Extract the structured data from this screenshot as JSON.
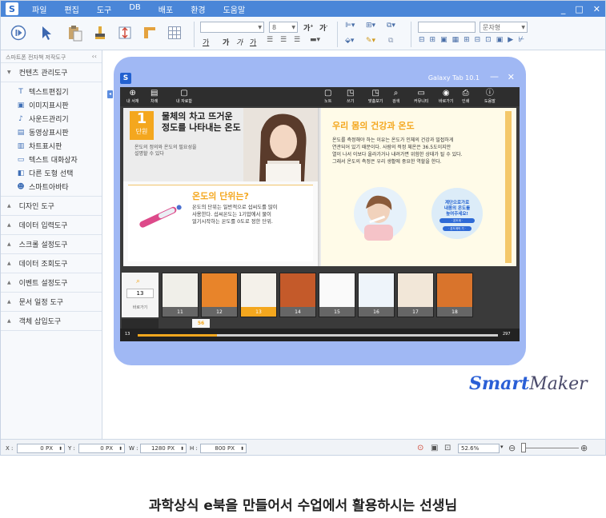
{
  "menu": {
    "items": [
      "파일",
      "편집",
      "도구",
      "DB",
      "배포",
      "환경",
      "도움말"
    ],
    "window_controls": [
      "_",
      "□",
      "✕"
    ]
  },
  "toolbar": {
    "font_size": "8",
    "font_style": "문자형",
    "text_buttons": [
      "가",
      "가",
      "가",
      "가"
    ]
  },
  "sidebar": {
    "title": "스마트폰 전자책 저작도구",
    "pin": "‹‹",
    "categories": [
      {
        "label": "컨텐츠 관리도구",
        "expanded": true,
        "items": [
          {
            "icon": "T",
            "label": "텍스트편집기"
          },
          {
            "icon": "▣",
            "label": "이미지표시판"
          },
          {
            "icon": "♪",
            "label": "사운드관리기"
          },
          {
            "icon": "▤",
            "label": "동영상표시판"
          },
          {
            "icon": "▥",
            "label": "차트표시판"
          },
          {
            "icon": "▭",
            "label": "텍스트 대화상자"
          },
          {
            "icon": "◧",
            "label": "다른 도형 선택"
          },
          {
            "icon": "☻",
            "label": "스마트아바타"
          }
        ]
      },
      {
        "label": "디자인 도구"
      },
      {
        "label": "데이터 입력도구"
      },
      {
        "label": "스크롤 설정도구"
      },
      {
        "label": "데이터 조회도구"
      },
      {
        "label": "이벤트 설정도구"
      },
      {
        "label": "문서 일정 도구"
      },
      {
        "label": "객체 삽입도구"
      }
    ]
  },
  "device": {
    "name": "Galaxy Tab 10.1",
    "min": "—",
    "close": "✕",
    "nav_left": [
      {
        "glyph": "⊕",
        "label": "내 서재"
      },
      {
        "glyph": "▤",
        "label": "차례"
      },
      {
        "glyph": "▢",
        "label": "내 자료함"
      }
    ],
    "nav_right": [
      {
        "glyph": "▢",
        "label": "노트"
      },
      {
        "glyph": "◳",
        "label": "쓰기"
      },
      {
        "glyph": "◳",
        "label": "맞춤보기"
      },
      {
        "glyph": "⌕",
        "label": "검색"
      },
      {
        "glyph": "▭",
        "label": "커뮤니티"
      },
      {
        "glyph": "◉",
        "label": "바로가기"
      },
      {
        "glyph": "⎙",
        "label": "인쇄"
      },
      {
        "glyph": "ⓘ",
        "label": "도움말"
      }
    ]
  },
  "book": {
    "unit_num": "1",
    "unit_word": "단원",
    "left_title": "물체의 차고 뜨거운\n정도를 나타내는 온도",
    "left_intro": "온도의 정의와 온도의 필요성을\n설명할 수 있다",
    "left_section": "온도의 단위는?",
    "left_body": "온도의 단위는 일반적으로 섭씨도를 많이\n사용한다. 섭씨온도는 1기압에서 물이\n얼기시작하는 온도를 0도로 정한 단위.",
    "right_title": "우리 몸의 건강과 온도",
    "right_body": "온도를 측정해야 하는 이유는 온도가 인체의 건강과 밀접하게\n연관되어 있기 때문이다. 사람의 적정 체온은 36.5도이지만\n열이 나서 이보다 올라가거나 내려가면 위험한 상태가 될 수 있다.\n그래서 온도의 측정은 우리 생활에 중요한 역할을 한다.",
    "bubble_text": "계단으로가로\n내몸의 온도를\n높여주세요!",
    "bubble_btns": [
      "· 온도계 ·",
      "· 온도계의 기 ·",
      "· 온도계의 종류 ·"
    ]
  },
  "thumbs": {
    "search_value": "13",
    "search_btn": "바로가기",
    "pages": [
      "11",
      "12",
      "13",
      "14",
      "15",
      "16",
      "17",
      "18"
    ],
    "selected": "13",
    "current_marker": "56",
    "range_start": "13",
    "range_end": "297",
    "progress": 0.22
  },
  "status": {
    "x_label": "X :",
    "x_value": "0 PX",
    "y_label": "Y :",
    "y_value": "0 PX",
    "w_label": "W :",
    "w_value": "1280 PX",
    "h_label": "H :",
    "h_value": "800 PX",
    "zoom": "52.6%"
  },
  "brand": {
    "smart": "Smart",
    "maker": "Maker"
  },
  "caption": "과학상식 e북을 만들어서 수업에서 활용하시는 선생님",
  "colors": {
    "accent": "#4a86d8",
    "device": "#a0b8f4",
    "orange": "#f4a71e",
    "brand": "#2a3f8f"
  }
}
